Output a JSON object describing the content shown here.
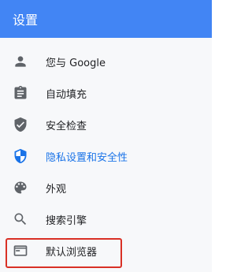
{
  "header": {
    "title": "设置"
  },
  "colors": {
    "header_bg": "#4285f4",
    "active": "#1a73e8",
    "highlight": "#d93025"
  },
  "menu": {
    "items": [
      {
        "label": "您与 Google",
        "icon": "person-icon"
      },
      {
        "label": "自动填充",
        "icon": "clipboard-icon"
      },
      {
        "label": "安全检查",
        "icon": "shield-check-icon"
      },
      {
        "label": "隐私设置和安全性",
        "icon": "privacy-shield-icon",
        "active": true
      },
      {
        "label": "外观",
        "icon": "palette-icon"
      },
      {
        "label": "搜索引擎",
        "icon": "search-icon",
        "highlighted": true
      },
      {
        "label": "默认浏览器",
        "icon": "browser-icon"
      }
    ]
  }
}
